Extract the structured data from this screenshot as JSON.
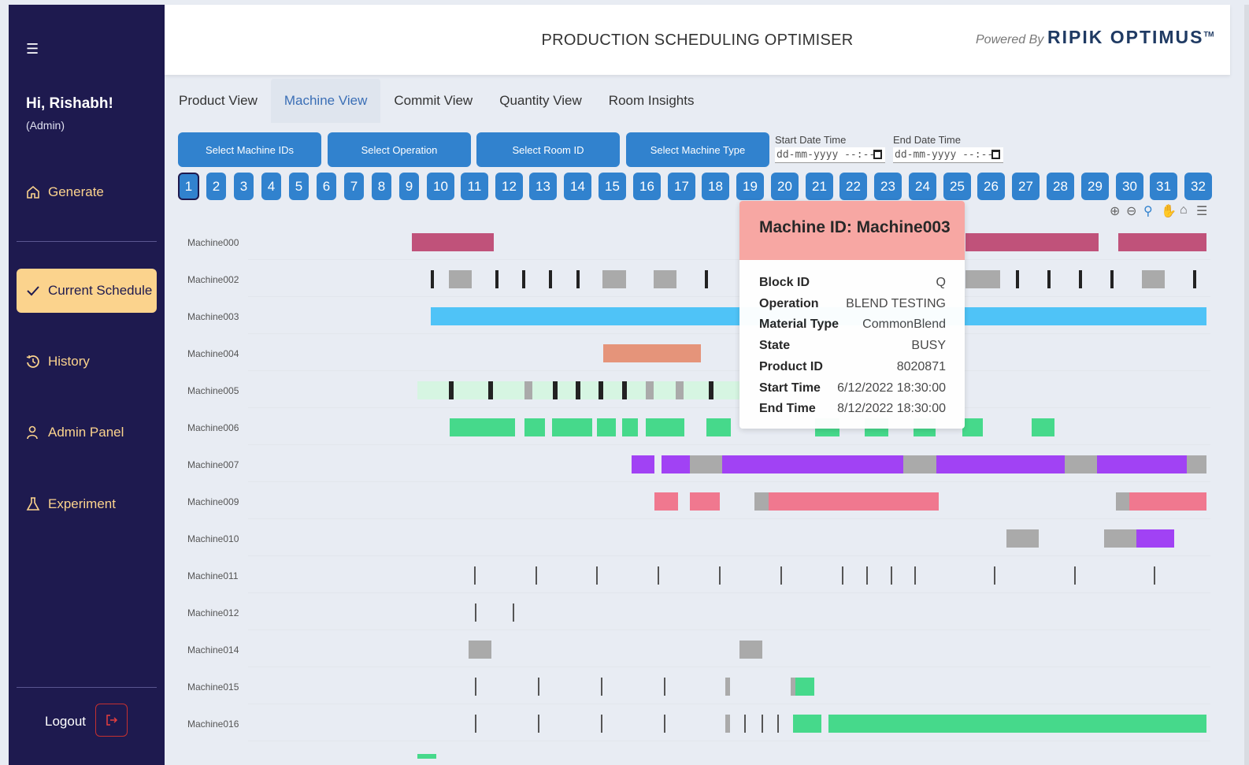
{
  "app": {
    "title": "PRODUCTION SCHEDULING OPTIMISER",
    "powered_by": "Powered By",
    "brand": "RIPIK OPTIMUS",
    "brand_tm": "TM"
  },
  "sidebar": {
    "menu_icon": "hamburger-icon",
    "greeting": "Hi, Rishabh!",
    "role": "(Admin)",
    "items": [
      {
        "label": "Generate",
        "icon": "home-icon"
      },
      {
        "label": "Current Schedule",
        "icon": "check-icon",
        "active": true
      },
      {
        "label": "History",
        "icon": "history-icon"
      },
      {
        "label": "Admin Panel",
        "icon": "user-icon"
      },
      {
        "label": "Experiment",
        "icon": "flask-icon"
      }
    ],
    "logout": "Logout",
    "logout_icon": "logout-icon"
  },
  "tabs": [
    "Product View",
    "Machine View",
    "Commit View",
    "Quantity View",
    "Room Insights"
  ],
  "active_tab": "Machine View",
  "filters": {
    "buttons": [
      "Select Machine IDs",
      "Select Operation",
      "Select Room ID",
      "Select Machine Type"
    ],
    "start_label": "Start Date Time",
    "end_label": "End Date Time",
    "start_placeholder": "dd-mm-yyyy --:--",
    "end_placeholder": "dd-mm-yyyy --:--"
  },
  "pages": [
    "1",
    "2",
    "3",
    "4",
    "5",
    "6",
    "7",
    "8",
    "9",
    "10",
    "11",
    "12",
    "13",
    "14",
    "15",
    "16",
    "17",
    "18",
    "19",
    "20",
    "21",
    "22",
    "23",
    "24",
    "25",
    "26",
    "27",
    "28",
    "29",
    "30",
    "31",
    "32"
  ],
  "active_page": "1",
  "toolbar": [
    "zoom-in-icon",
    "zoom-out-icon",
    "zoom-select-icon",
    "pan-icon",
    "reset-home-icon",
    "menu-icon"
  ],
  "colors": {
    "sidebar_bg": "#1e1a4f",
    "accent": "#3182ce",
    "active_nav": "#fbd38d",
    "tooltip_header": "#f8a5a1"
  },
  "machines": [
    "Machine000",
    "Machine002",
    "Machine003",
    "Machine004",
    "Machine005",
    "Machine006",
    "Machine007",
    "Machine009",
    "Machine010",
    "Machine011",
    "Machine012",
    "Machine014",
    "Machine015",
    "Machine016"
  ],
  "tooltip": {
    "title": "Machine ID: Machine003",
    "rows": [
      {
        "key": "Block ID",
        "value": "Q"
      },
      {
        "key": "Operation",
        "value": "BLEND TESTING"
      },
      {
        "key": "Material Type",
        "value": "CommonBlend"
      },
      {
        "key": "State",
        "value": "BUSY"
      },
      {
        "key": "Product ID",
        "value": "8020871"
      },
      {
        "key": "Start Time",
        "value": "6/12/2022 18:30:00"
      },
      {
        "key": "End Time",
        "value": "8/12/2022 18:30:00"
      }
    ]
  }
}
